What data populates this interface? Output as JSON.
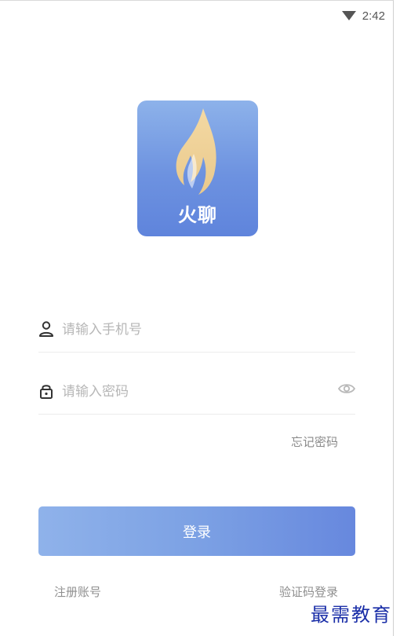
{
  "status_bar": {
    "time": "2:42",
    "wifi_icon": "wifi-icon"
  },
  "logo": {
    "text": "火聊",
    "icon": "flame-icon"
  },
  "phone": {
    "placeholder": "请输入手机号",
    "value": "",
    "icon": "user-icon"
  },
  "password": {
    "placeholder": "请输入密码",
    "value": "",
    "icon": "lock-icon",
    "toggle_icon": "eye-icon"
  },
  "forgot_label": "忘记密码",
  "login_label": "登录",
  "register_label": "注册账号",
  "sms_login_label": "验证码登录",
  "watermark": "最需教育",
  "colors": {
    "accent_start": "#8fb2ea",
    "accent_end": "#6788de"
  }
}
